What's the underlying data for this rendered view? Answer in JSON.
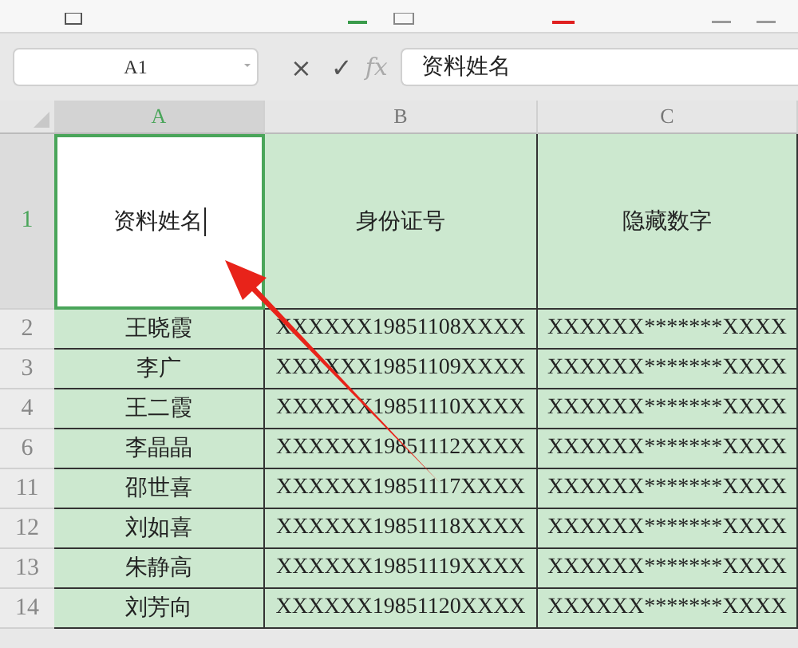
{
  "formula_bar": {
    "name_box": "A1",
    "cancel": "×",
    "confirm": "✓",
    "fx": "fx",
    "value": "资料姓名"
  },
  "sheet": {
    "columns": [
      {
        "label": "A",
        "selected": true
      },
      {
        "label": "B",
        "selected": false
      },
      {
        "label": "C",
        "selected": false
      }
    ],
    "rows": [
      {
        "number": "1",
        "selected": true,
        "cells": [
          "资料姓名",
          "身份证号",
          "隐藏数字"
        ]
      },
      {
        "number": "2",
        "selected": false,
        "cells": [
          "王晓霞",
          "XXXXXX19851108XXXX",
          "XXXXXX*******XXXX"
        ]
      },
      {
        "number": "3",
        "selected": false,
        "cells": [
          "李广",
          "XXXXXX19851109XXXX",
          "XXXXXX*******XXXX"
        ]
      },
      {
        "number": "4",
        "selected": false,
        "cells": [
          "王二霞",
          "XXXXXX19851110XXXX",
          "XXXXXX*******XXXX"
        ]
      },
      {
        "number": "6",
        "selected": false,
        "cells": [
          "李晶晶",
          "XXXXXX19851112XXXX",
          "XXXXXX*******XXXX"
        ]
      },
      {
        "number": "11",
        "selected": false,
        "cells": [
          "邵世喜",
          "XXXXXX19851117XXXX",
          "XXXXXX*******XXXX"
        ]
      },
      {
        "number": "12",
        "selected": false,
        "cells": [
          "刘如喜",
          "XXXXXX19851118XXXX",
          "XXXXXX*******XXXX"
        ]
      },
      {
        "number": "13",
        "selected": false,
        "cells": [
          "朱静高",
          "XXXXXX19851119XXXX",
          "XXXXXX*******XXXX"
        ]
      },
      {
        "number": "14",
        "selected": false,
        "cells": [
          "刘芳向",
          "XXXXXX19851120XXXX",
          "XXXXXX*******XXXX"
        ]
      }
    ]
  }
}
